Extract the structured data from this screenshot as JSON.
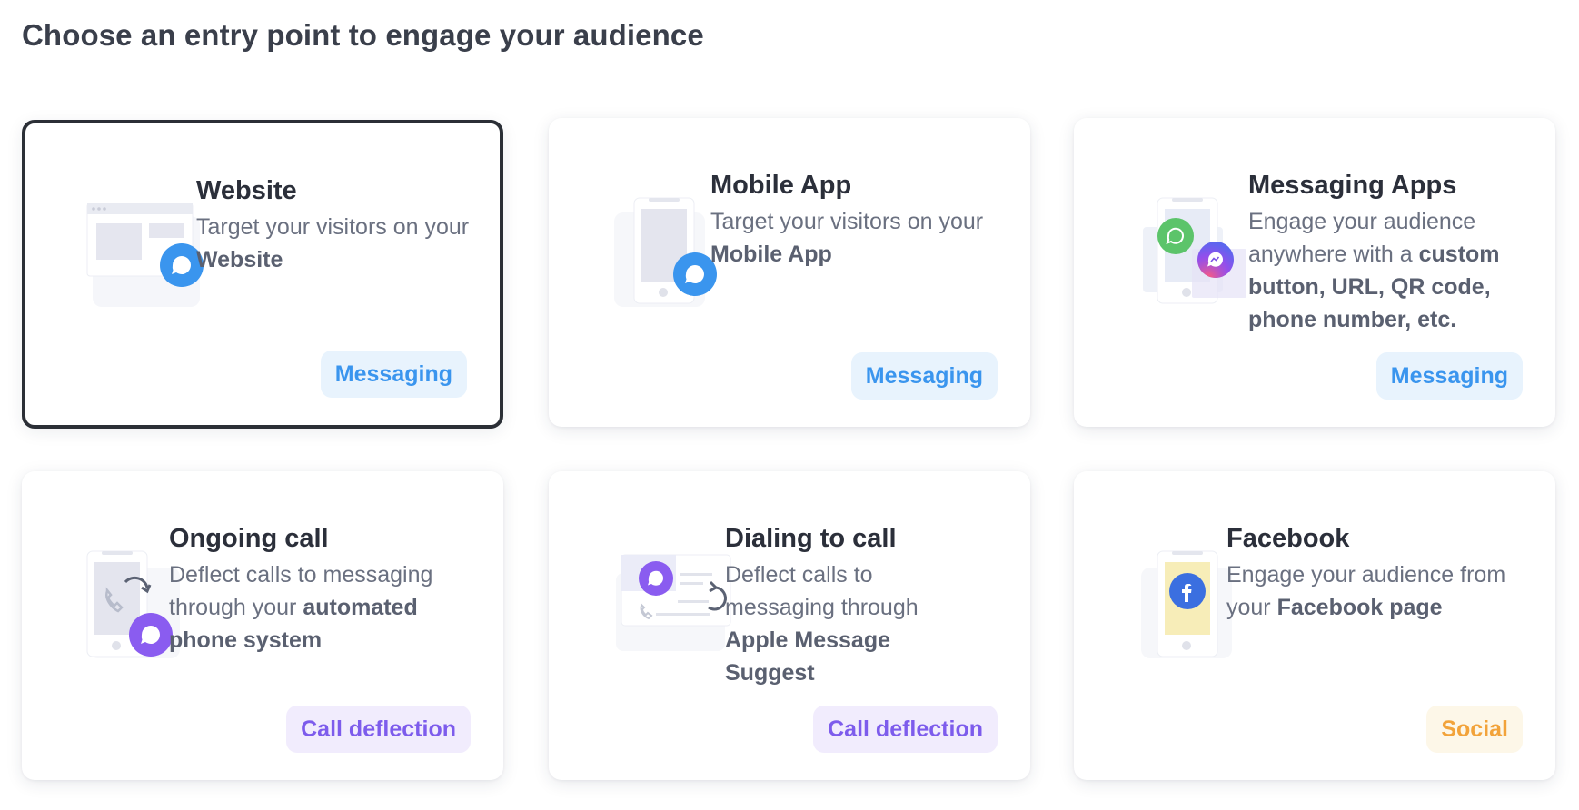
{
  "page": {
    "title": "Choose an entry point to engage your audience"
  },
  "colors": {
    "messaging_badge_bg": "#e8f3fd",
    "messaging_badge_text": "#3a95ee",
    "call_badge_bg": "#f1ecfd",
    "call_badge_text": "#7d5cec",
    "social_badge_bg": "#fdf7e8",
    "social_badge_text": "#f2a33a",
    "selected_border": "#2b2f36"
  },
  "cards": [
    {
      "id": "website",
      "title": "Website",
      "desc_pre": "Target your visitors on your ",
      "desc_bold": "Website",
      "desc_post": "",
      "badge": "Messaging",
      "selected": true
    },
    {
      "id": "mobile-app",
      "title": "Mobile App",
      "desc_pre": "Target your visitors on your ",
      "desc_bold": "Mobile App",
      "desc_post": "",
      "badge": "Messaging",
      "selected": false
    },
    {
      "id": "messaging-apps",
      "title": "Messaging Apps",
      "desc_pre": "Engage your audience anywhere with a ",
      "desc_bold": "custom button, URL, QR code, phone number, etc.",
      "desc_post": "",
      "badge": "Messaging",
      "selected": false
    },
    {
      "id": "ongoing-call",
      "title": "Ongoing call",
      "desc_pre": "Deflect calls to messaging through your ",
      "desc_bold": "automated phone system",
      "desc_post": "",
      "badge": "Call deflection",
      "selected": false
    },
    {
      "id": "dialing-to-call",
      "title": "Dialing to call",
      "desc_pre": "Deflect calls to messaging through ",
      "desc_bold": "Apple Message Suggest",
      "desc_post": "",
      "badge": "Call deflection",
      "selected": false
    },
    {
      "id": "facebook",
      "title": "Facebook",
      "desc_pre": "Engage your audience from your ",
      "desc_bold": "Facebook page",
      "desc_post": "",
      "badge": "Social",
      "selected": false
    }
  ]
}
